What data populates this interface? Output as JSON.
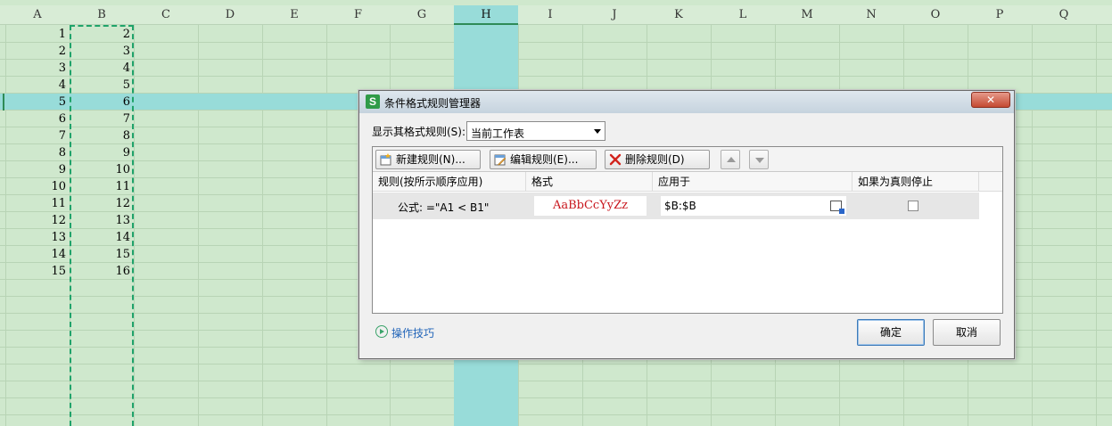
{
  "sheet": {
    "columns": [
      "A",
      "B",
      "C",
      "D",
      "E",
      "F",
      "G",
      "H",
      "I",
      "J",
      "K",
      "L",
      "M",
      "N",
      "O",
      "P",
      "Q"
    ],
    "selected_column": "H",
    "selected_row": 5,
    "col_a_values": [
      "1",
      "2",
      "3",
      "4",
      "5",
      "6",
      "7",
      "8",
      "9",
      "10",
      "11",
      "12",
      "13",
      "14",
      "15"
    ],
    "col_b_values": [
      "2",
      "3",
      "4",
      "5",
      "6",
      "7",
      "8",
      "9",
      "10",
      "11",
      "12",
      "13",
      "14",
      "15",
      "16"
    ]
  },
  "dialog": {
    "title": "条件格式规则管理器",
    "app_icon_letter": "S",
    "close_glyph": "✕",
    "show_rules_label": "显示其格式规则(S):",
    "show_rules_value": "当前工作表",
    "toolbar": {
      "new_rule": "新建规则(N)...",
      "edit_rule": "编辑规则(E)...",
      "delete_rule": "删除规则(D)"
    },
    "table": {
      "headers": [
        "规则(按所示顺序应用)",
        "格式",
        "应用于",
        "如果为真则停止"
      ],
      "rows": [
        {
          "condition": "公式: =\"A1 < B1\"",
          "format_preview": "AaBbCcYyZz",
          "applies_to": "$B:$B",
          "stop_if_true": false
        }
      ]
    },
    "tips_link": "操作技巧",
    "ok_button": "确定",
    "cancel_button": "取消"
  },
  "colors": {
    "sheet_bg": "#cfe8cd",
    "selection": "#98dcd9",
    "preview_text": "#c8161d",
    "link": "#1f63b8",
    "marching_ants": "#1fa36a"
  }
}
